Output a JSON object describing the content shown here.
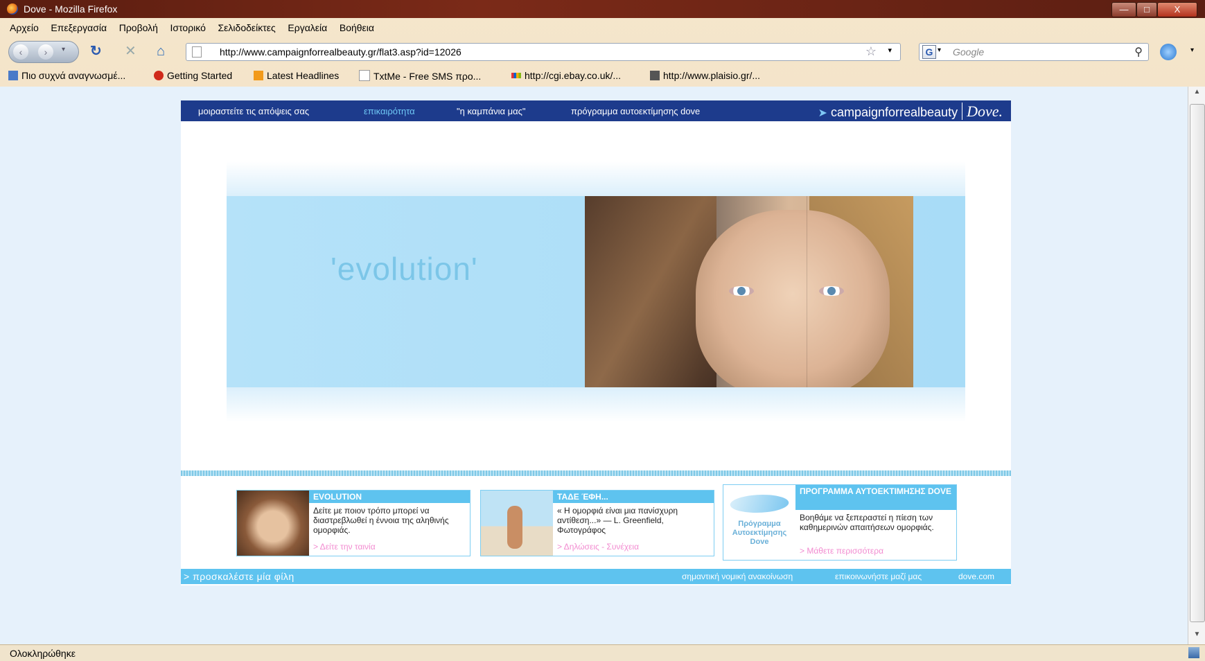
{
  "window": {
    "title": "Dove - Mozilla Firefox",
    "min": "—",
    "max": "□",
    "close": "X"
  },
  "menu": [
    "Αρχείο",
    "Επεξεργασία",
    "Προβολή",
    "Ιστορικό",
    "Σελιδοδείκτες",
    "Εργαλεία",
    "Βοήθεια"
  ],
  "navbar": {
    "url": "http://www.campaignforrealbeauty.gr/flat3.asp?id=12026",
    "search_engine": "G",
    "search_placeholder": "Google",
    "icons": [
      "back-icon",
      "forward-icon",
      "reload-icon",
      "stop-icon",
      "home-icon",
      "bookmark-star-icon",
      "search-icon"
    ]
  },
  "bookmarks": [
    {
      "label": "Πιο συχνά αναγνωσμέ..."
    },
    {
      "label": "Getting Started"
    },
    {
      "label": "Latest Headlines"
    },
    {
      "label": "TxtMe - Free SMS προ..."
    },
    {
      "label": "http://cgi.ebay.co.uk/..."
    },
    {
      "label": "http://www.plaisio.gr/..."
    }
  ],
  "page": {
    "topnav": [
      "μοιραστείτε τις απόψεις σας",
      "επικαιρότητα",
      "\"η καμπάνια μας\"",
      "πρόγραμμα αυτοεκτίμησης dove"
    ],
    "active_index": 1,
    "logo_main": "campaignforrealbeauty",
    "logo_brand": "Dove.",
    "hero_title": "'evolution'",
    "cards": [
      {
        "head": "EVOLUTION",
        "body": "Δείτε με ποιον τρόπο μπορεί να διαστρεβλωθεί η έννοια της αληθινής ομορφιάς.",
        "link": "> Δείτε την ταινία"
      },
      {
        "head": "ΤΑΔΕ ΈΦΗ...",
        "body": "« Η ομορφιά είναι μια πανίσχυρη αντίθεση...» — L. Greenfield, Φωτογράφος",
        "link": "> Δηλώσεις - Συνέχεια"
      },
      {
        "head": "ΠΡΟΓΡΑΜΜΑ ΑΥΤΟΕΚΤΙΜΗΣΗΣ DOVE",
        "body": "Βοηθάμε να ξεπεραστεί η πίεση των καθημερινών απαιτήσεων ομορφιάς.",
        "link": "> Μάθετε περισσότερα",
        "thumb_text": "Πρόγραμμα Αυτοεκτίμησης Dove"
      }
    ],
    "bottom": {
      "invite": "> προσκαλέστε μία φίλη",
      "links": [
        "σημαντική νομική ανακοίνωση",
        "επικοινωνήστε μαζί μας",
        "dove.com"
      ]
    }
  },
  "status": {
    "text": "Ολοκληρώθηκε"
  },
  "colors": {
    "nav_bg": "#1d3b8c",
    "accent": "#5ec3ef",
    "link_pink": "#f28bd0",
    "hero_text": "#7cc6e8"
  }
}
